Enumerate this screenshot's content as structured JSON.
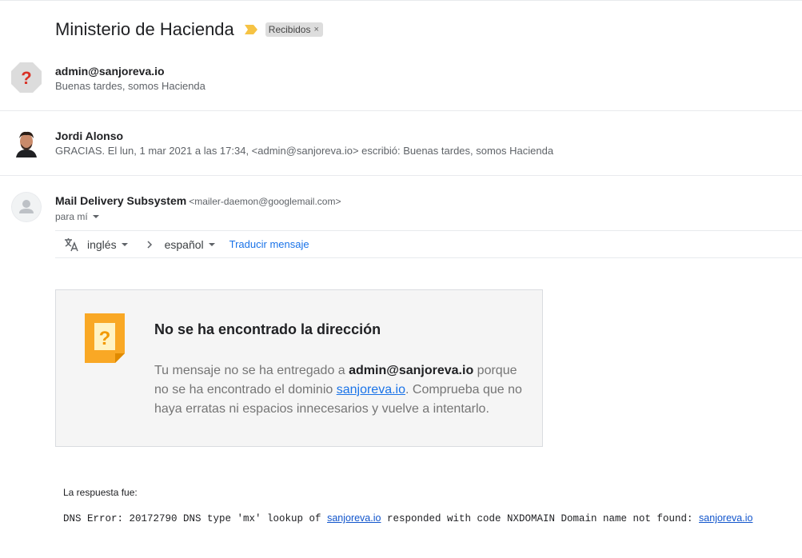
{
  "thread": {
    "subject": "Ministerio de Hacienda",
    "label": "Recibidos",
    "label_close": "×",
    "label_color": "#dddddd",
    "importance_color": "#f6c344"
  },
  "messages": [
    {
      "sender": "admin@sanjoreva.io",
      "snippet": "Buenas tardes, somos Hacienda",
      "avatar_icon": "unknown-sender-icon",
      "avatar_mark": "?"
    },
    {
      "sender": "Jordi Alonso",
      "snippet": "GRACIAS. El lun, 1 mar 2021 a las 17:34, <admin@sanjoreva.io> escribió: Buenas tardes, somos Hacienda",
      "avatar_icon": "user-photo"
    },
    {
      "sender": "Mail Delivery Subsystem",
      "email": "<mailer-daemon@googlemail.com>",
      "to": "para mí",
      "avatar_icon": "default-avatar-icon"
    }
  ],
  "translate": {
    "source_lang": "inglés",
    "target_lang": "español",
    "action": "Traducir mensaje",
    "link_color": "#1a73e8"
  },
  "bounce": {
    "title": "No se ha encontrado la dirección",
    "body_1": "Tu mensaje no se ha entregado a ",
    "address": "admin@sanjoreva.io",
    "body_2": " porque no se ha encontrado el dominio ",
    "domain": "sanjoreva.io",
    "body_3": ". Comprueba que no haya erratas ni espacios innecesarios y vuelve a intentarlo.",
    "icon_mark": "?",
    "icon_color": "#f9a825"
  },
  "response": {
    "label": "La respuesta fue:",
    "line_1": "DNS Error: 20172790 DNS type 'mx' lookup of ",
    "domain_1": "sanjoreva.io",
    "line_2": " responded with code NXDOMAIN Domain name not found: ",
    "domain_2": "sanjoreva.io"
  }
}
